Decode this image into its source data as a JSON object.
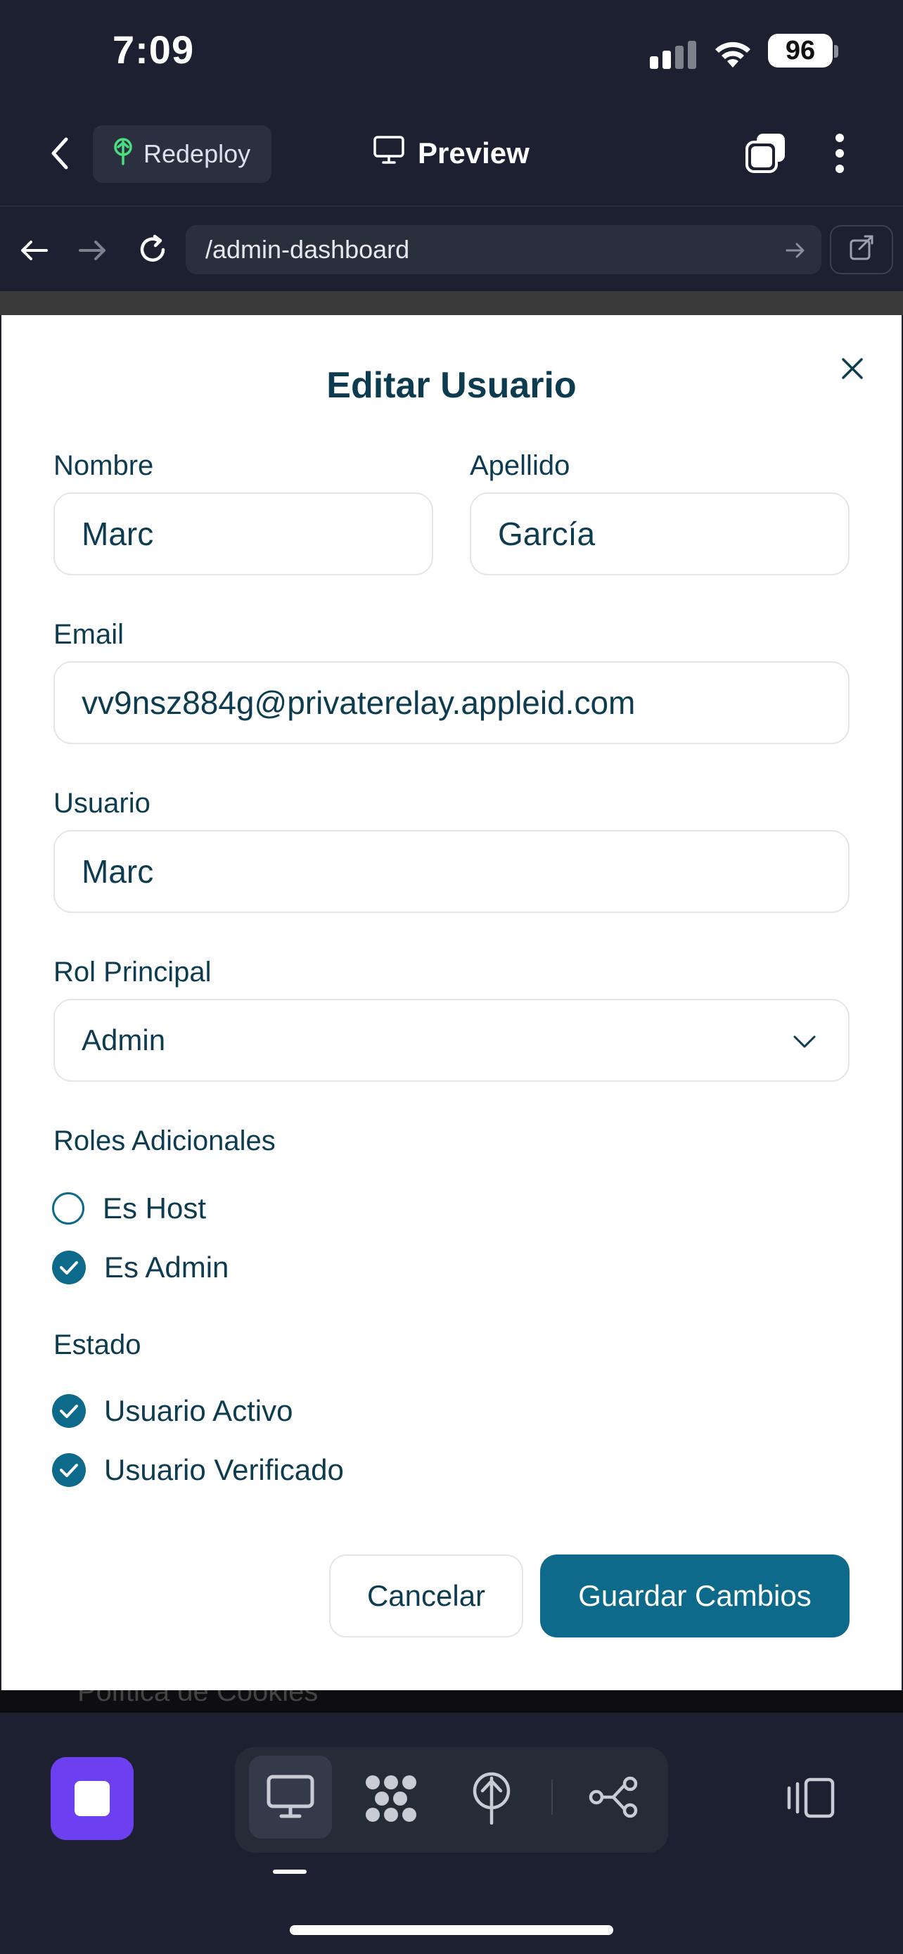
{
  "status_bar": {
    "time": "7:09",
    "battery": "96"
  },
  "app_bar": {
    "redeploy_label": "Redeploy",
    "preview_label": "Preview"
  },
  "browser": {
    "url": "/admin-dashboard"
  },
  "modal": {
    "title": "Editar Usuario",
    "fields": {
      "nombre_label": "Nombre",
      "nombre_value": "Marc",
      "apellido_label": "Apellido",
      "apellido_value": "García",
      "email_label": "Email",
      "email_value": "vv9nsz884g@privaterelay.appleid.com",
      "usuario_label": "Usuario",
      "usuario_value": "Marc",
      "rol_label": "Rol Principal",
      "rol_value": "Admin"
    },
    "roles_adicionales": {
      "heading": "Roles Adicionales",
      "items": [
        {
          "label": "Es Host",
          "checked": false
        },
        {
          "label": "Es Admin",
          "checked": true
        }
      ]
    },
    "estado": {
      "heading": "Estado",
      "items": [
        {
          "label": "Usuario Activo",
          "checked": true
        },
        {
          "label": "Usuario Verificado",
          "checked": true
        }
      ]
    },
    "buttons": {
      "cancel": "Cancelar",
      "save": "Guardar Cambios"
    }
  },
  "background_peek": {
    "text": "Política de Cookies"
  },
  "colors": {
    "accent": "#0e6a8a",
    "text": "#0d3b4f",
    "stop_button": "#6c3ff0",
    "dark_bg": "#1c2030"
  }
}
